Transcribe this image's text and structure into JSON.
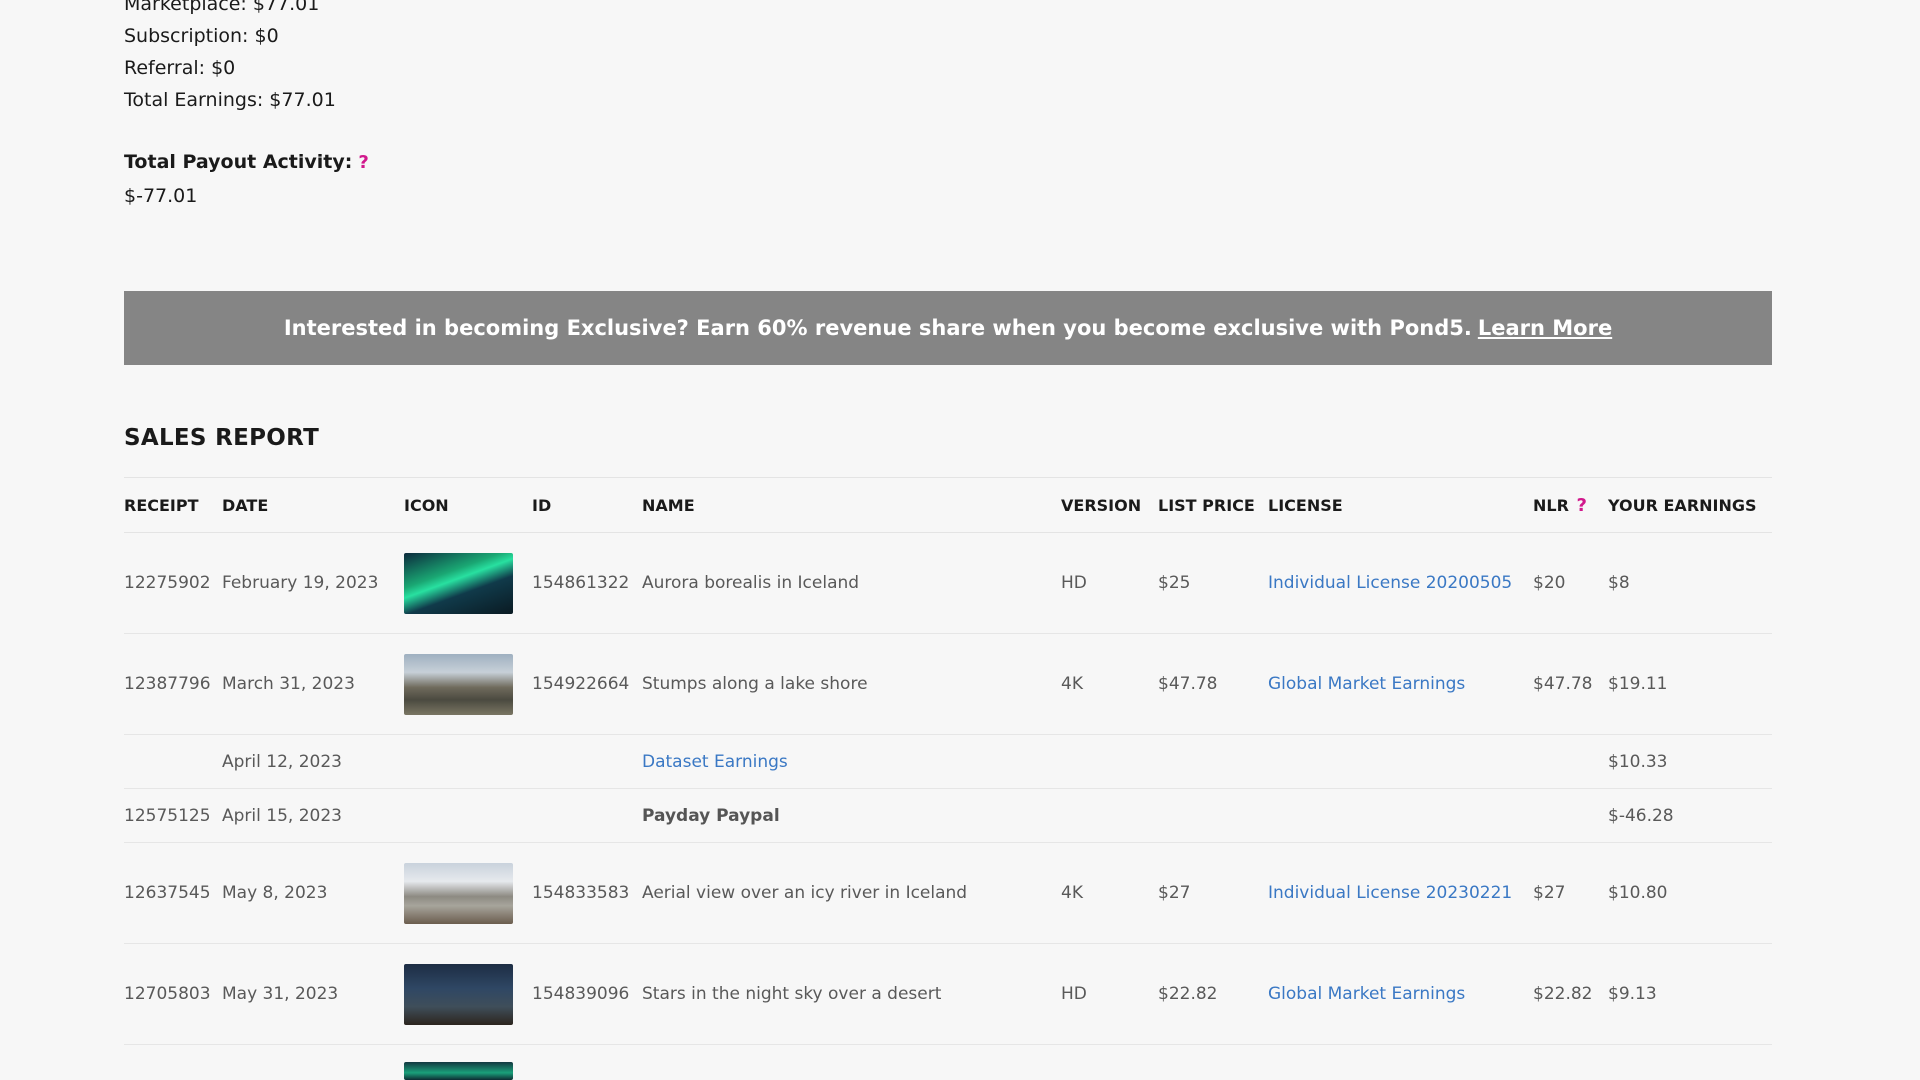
{
  "earnings": {
    "marketplace": "Marketplace: $77.01",
    "subscription": "Subscription: $0",
    "referral": "Referral: $0",
    "total": "Total Earnings: $77.01"
  },
  "payout": {
    "label": "Total Payout Activity:",
    "help": "?",
    "value": "$-77.01"
  },
  "banner": {
    "text": "Interested in becoming Exclusive? Earn 60% revenue share when you become exclusive with Pond5.",
    "link": "Learn More"
  },
  "sales": {
    "title": "SALES REPORT",
    "columns": {
      "receipt": "RECEIPT",
      "date": "DATE",
      "icon": "ICON",
      "id": "ID",
      "name": "NAME",
      "version": "VERSION",
      "list_price": "LIST PRICE",
      "license": "LICENSE",
      "nlr": "NLR",
      "nlr_help": "?",
      "earnings": "YOUR EARNINGS"
    },
    "rows": [
      {
        "receipt": "12275902",
        "date": "February 19, 2023",
        "icon": "aurora-thumbnail",
        "id": "154861322",
        "name": "Aurora borealis in Iceland",
        "version": "HD",
        "list_price": "$25",
        "license": "Individual License 20200505",
        "nlr": "$20",
        "earnings": "$8"
      },
      {
        "receipt": "12387796",
        "date": "March 31, 2023",
        "icon": "lake-stumps-thumbnail",
        "id": "154922664",
        "name": "Stumps along a lake shore",
        "version": "4K",
        "list_price": "$47.78",
        "license": "Global Market Earnings",
        "nlr": "$47.78",
        "earnings": "$19.11"
      },
      {
        "receipt": "",
        "date": "April 12, 2023",
        "name": "Dataset Earnings",
        "earnings": "$10.33"
      },
      {
        "receipt": "12575125",
        "date": "April 15, 2023",
        "name": "Payday Paypal",
        "earnings": "$-46.28"
      },
      {
        "receipt": "12637545",
        "date": "May 8, 2023",
        "icon": "icy-river-thumbnail",
        "id": "154833583",
        "name": "Aerial view over an icy river in Iceland",
        "version": "4K",
        "list_price": "$27",
        "license": "Individual License 20230221",
        "nlr": "$27",
        "earnings": "$10.80"
      },
      {
        "receipt": "12705803",
        "date": "May 31, 2023",
        "icon": "night-sky-thumbnail",
        "id": "154839096",
        "name": "Stars in the night sky over a desert",
        "version": "HD",
        "list_price": "$22.82",
        "license": "Global Market Earnings",
        "nlr": "$22.82",
        "earnings": "$9.13"
      }
    ]
  }
}
